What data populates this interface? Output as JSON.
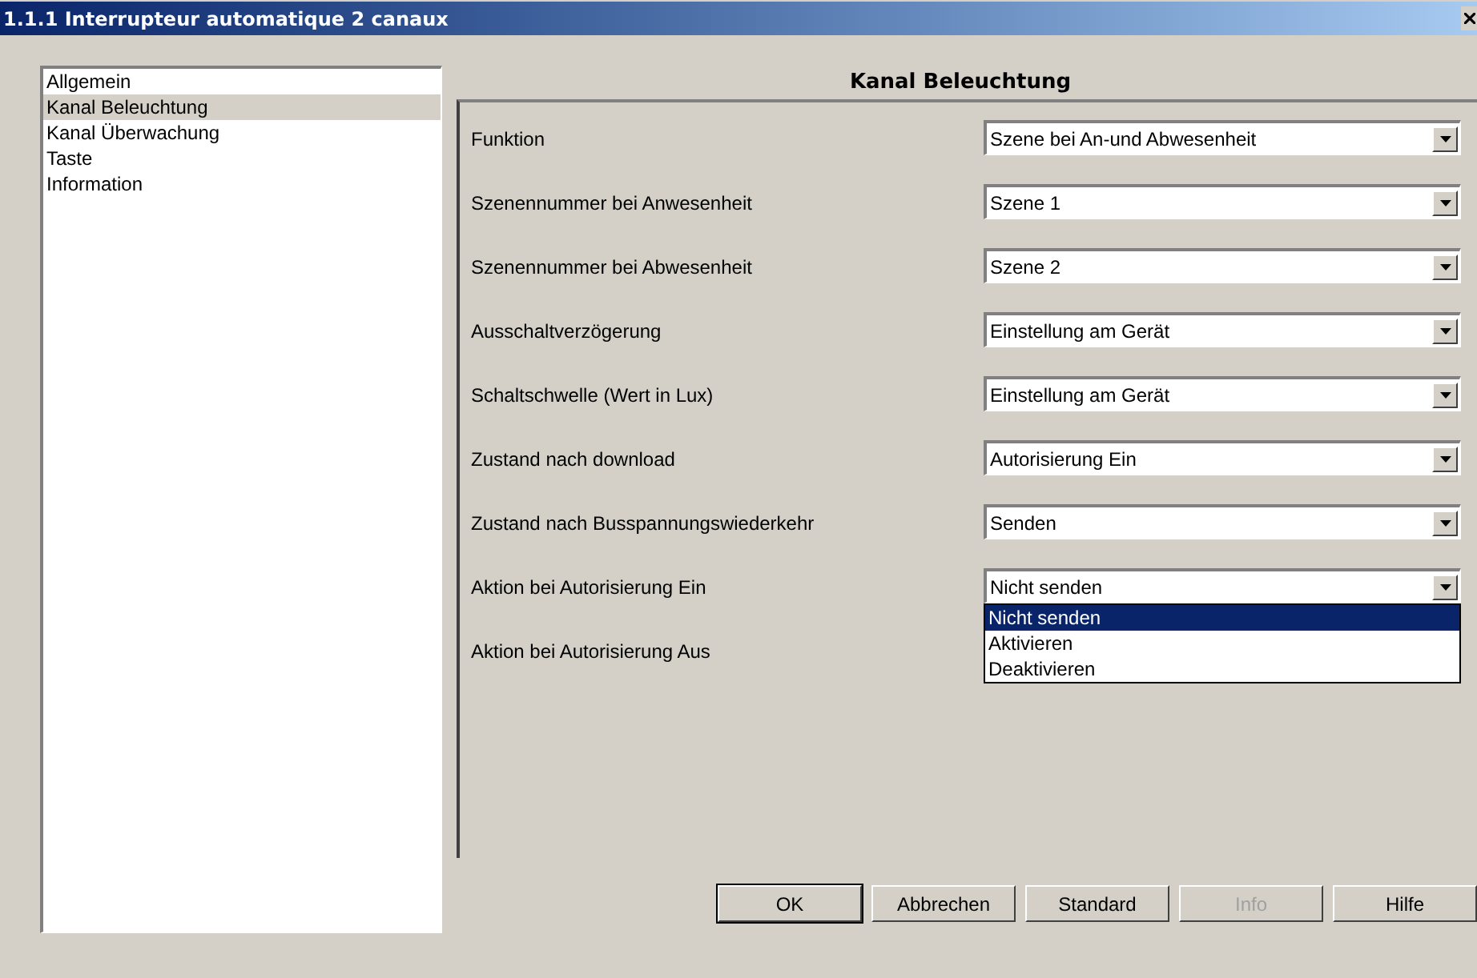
{
  "window": {
    "title": "1.1.1 Interrupteur automatique 2 canaux"
  },
  "sidebar": {
    "items": [
      {
        "label": "Allgemein",
        "selected": false
      },
      {
        "label": "Kanal Beleuchtung",
        "selected": true
      },
      {
        "label": "Kanal Überwachung",
        "selected": false
      },
      {
        "label": "Taste",
        "selected": false
      },
      {
        "label": "Information",
        "selected": false
      }
    ]
  },
  "panel": {
    "heading": "Kanal Beleuchtung",
    "parameters": [
      {
        "label": "Funktion",
        "value": "Szene bei An-und Abwesenheit"
      },
      {
        "label": "Szenennummer bei Anwesenheit",
        "value": "Szene 1"
      },
      {
        "label": "Szenennummer bei Abwesenheit",
        "value": "Szene 2"
      },
      {
        "label": "Ausschaltverzögerung",
        "value": "Einstellung am Gerät"
      },
      {
        "label": "Schaltschwelle (Wert in Lux)",
        "value": "Einstellung am Gerät"
      },
      {
        "label": "Zustand nach download",
        "value": "Autorisierung Ein"
      },
      {
        "label": "Zustand nach Busspannungswiederkehr",
        "value": "Senden"
      },
      {
        "label": "Aktion bei Autorisierung Ein",
        "value": "Nicht senden",
        "open": true,
        "options": [
          {
            "label": "Nicht senden",
            "selected": true
          },
          {
            "label": "Aktivieren",
            "selected": false
          },
          {
            "label": "Deaktivieren",
            "selected": false
          }
        ]
      },
      {
        "label": "Aktion bei Autorisierung Aus"
      }
    ]
  },
  "buttons": [
    {
      "label": "OK",
      "default": true,
      "disabled": false
    },
    {
      "label": "Abbrechen",
      "default": false,
      "disabled": false
    },
    {
      "label": "Standard",
      "default": false,
      "disabled": false
    },
    {
      "label": "Info",
      "default": false,
      "disabled": true
    },
    {
      "label": "Hilfe",
      "default": false,
      "disabled": false
    }
  ]
}
